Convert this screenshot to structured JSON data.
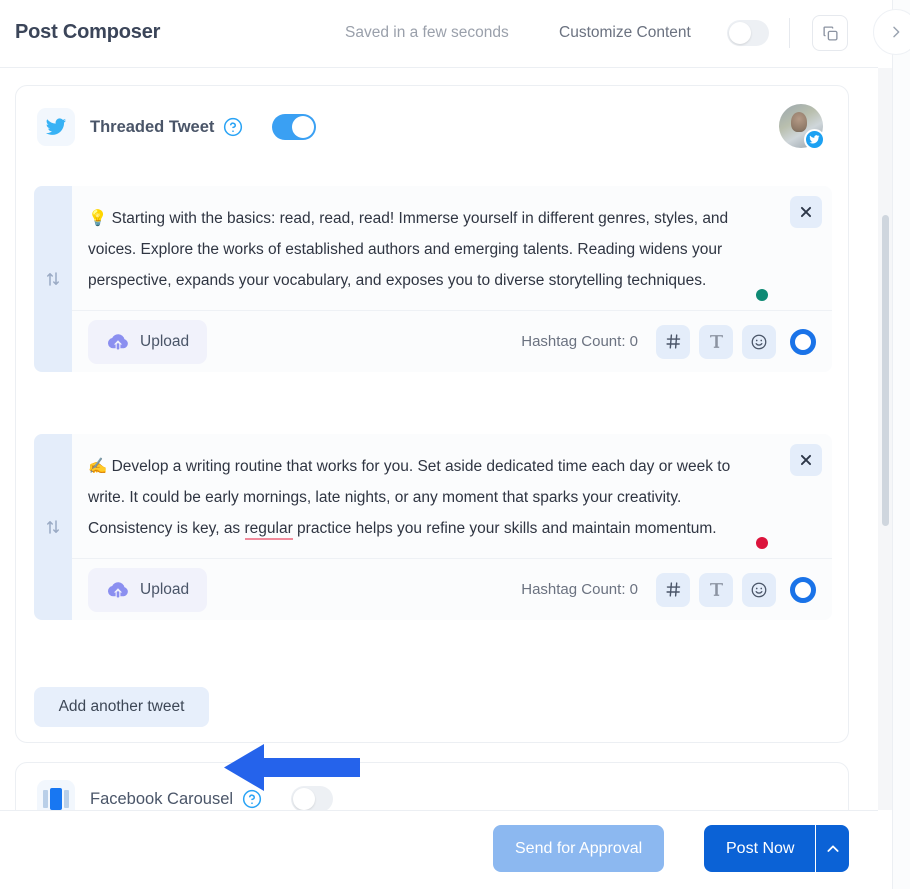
{
  "header": {
    "title": "Post Composer",
    "saved_status": "Saved in a few seconds",
    "customize_label": "Customize Content",
    "customize_toggle_state": "off",
    "copy_icon": "copy-icon",
    "next_icon": "chevron-right-icon"
  },
  "platform_card": {
    "icon": "twitter-icon",
    "label": "Threaded Tweet",
    "help_icon": "help-circle-icon",
    "toggle_state": "on",
    "avatar": "user-avatar",
    "avatar_badge": "twitter-badge-icon"
  },
  "tweets": [
    {
      "drag_icon": "drag-sort-icon",
      "text_prefix": "💡 Starting with the basics: read, read, read! Immerse yourself in different genres, styles, and voices. Explore the works of established authors and emerging talents. Reading widens your perspective, expands your vocabulary, and exposes you to diverse storytelling techniques.",
      "status_dot_color": "#0e8a74",
      "close_icon": "close-icon",
      "upload_label": "Upload",
      "upload_icon": "cloud-upload-icon",
      "hashtag_count_label": "Hashtag Count: 0",
      "hashtag_icon": "hashtag-icon",
      "text_format_icon": "text-format-icon",
      "emoji_icon": "emoji-icon",
      "char_counter": "character-count-ring"
    },
    {
      "drag_icon": "drag-sort-icon",
      "text_before": "✍️ Develop a writing routine that works for you. Set aside dedicated time each day or week to write. It could be early mornings, late nights, or any moment that sparks your creativity. Consistency is key, as ",
      "text_misspelled": "regular",
      "text_after": " practice helps you refine your skills and maintain momentum.",
      "status_dot_color": "#dc143c",
      "close_icon": "close-icon",
      "upload_label": "Upload",
      "upload_icon": "cloud-upload-icon",
      "hashtag_count_label": "Hashtag Count: 0",
      "hashtag_icon": "hashtag-icon",
      "text_format_icon": "text-format-icon",
      "emoji_icon": "emoji-icon",
      "char_counter": "character-count-ring"
    }
  ],
  "add_tweet_label": "Add another tweet",
  "annotation": {
    "type": "left-pointing-arrow",
    "color": "#2563eb"
  },
  "facebook_card": {
    "icon": "carousel-icon",
    "label": "Facebook Carousel",
    "help_icon": "help-circle-icon",
    "toggle_state": "off"
  },
  "footer": {
    "send_approval_label": "Send for Approval",
    "post_now_label": "Post Now",
    "post_now_caret_icon": "chevron-up-icon"
  },
  "colors": {
    "accent_blue": "#1a73e8",
    "twitter_blue": "#1da1f2",
    "primary_button": "#0b62d6",
    "secondary_button": "#8cb8f0",
    "upload_purple": "#7b7fe8",
    "spell_error": "#f08a9b"
  }
}
